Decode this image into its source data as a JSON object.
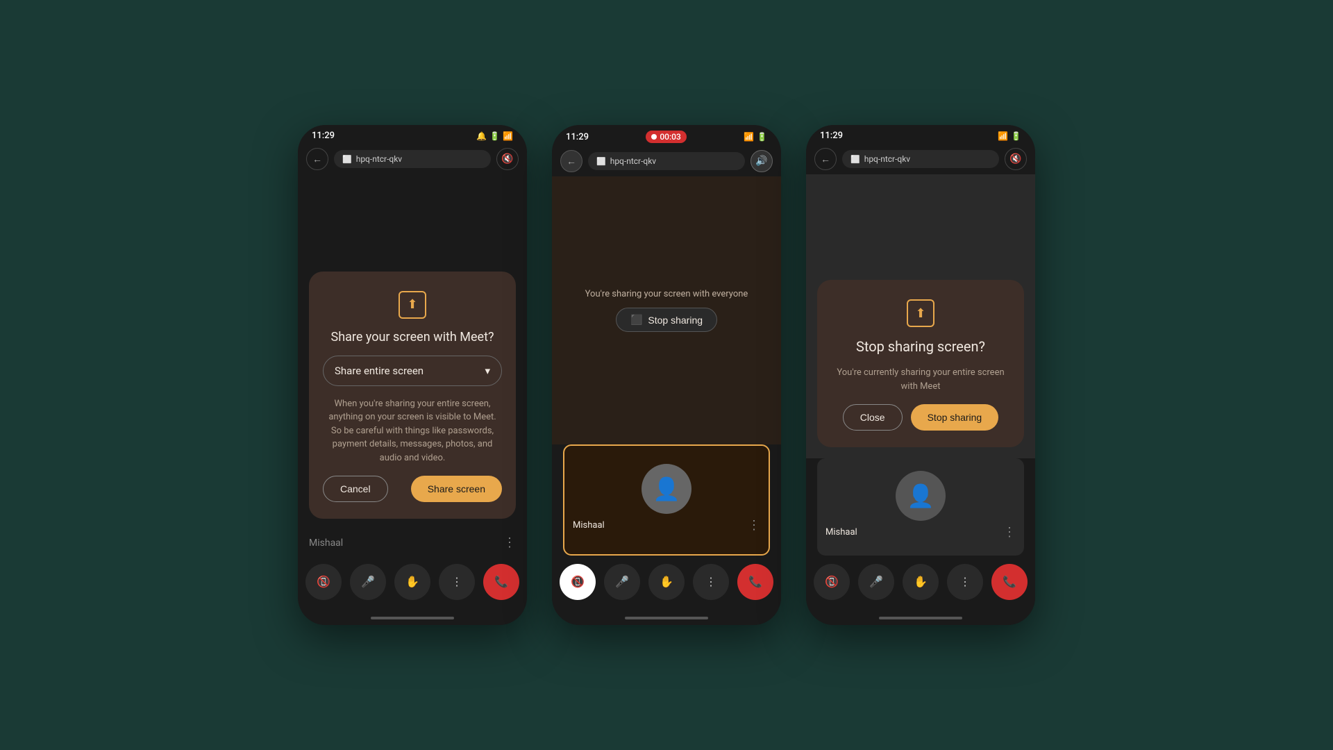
{
  "background": "#1a3a35",
  "phones": [
    {
      "id": "phone1",
      "status_bar": {
        "time": "11:29",
        "icons": [
          "notification",
          "battery",
          "wifi"
        ],
        "recording": null
      },
      "nav": {
        "back_label": "←",
        "url": "hpq-ntcr-qkv",
        "sound_icon": "🔇"
      },
      "modal": {
        "icon": "⬆",
        "title": "Share your screen with Meet?",
        "dropdown_label": "Share entire screen",
        "dropdown_icon": "▾",
        "description": "When you're sharing your entire screen, anything on your screen is visible to Meet. So be careful with things like passwords, payment details, messages, photos, and audio and video.",
        "cancel_label": "Cancel",
        "share_label": "Share screen"
      },
      "user_bar": {
        "name": "Mishaal",
        "dots": "⋮"
      },
      "controls": [
        "📵",
        "🎤",
        "✋",
        "⋮",
        "📞"
      ]
    },
    {
      "id": "phone2",
      "status_bar": {
        "time": "11:29",
        "recording_label": "00:03"
      },
      "nav": {
        "back_label": "←",
        "url": "hpq-ntcr-qkv",
        "sound_icon": "🔊"
      },
      "share_area": {
        "message": "You're sharing your screen with everyone",
        "stop_sharing_label": "Stop sharing",
        "stop_icon": "⬛"
      },
      "participant": {
        "name": "Mishaal",
        "dots": "⋮"
      },
      "controls": [
        "📵",
        "🎤",
        "✋",
        "⋮",
        "📞"
      ]
    },
    {
      "id": "phone3",
      "status_bar": {
        "time": "11:29"
      },
      "nav": {
        "back_label": "←",
        "url": "hpq-ntcr-qkv",
        "sound_icon": "🔇"
      },
      "modal": {
        "icon": "⬆",
        "title": "Stop sharing screen?",
        "description": "You're currently sharing your entire screen with Meet",
        "close_label": "Close",
        "stop_label": "Stop sharing"
      },
      "participant": {
        "name": "Mishaal",
        "dots": "⋮"
      },
      "controls": [
        "📵",
        "🎤",
        "✋",
        "⋮",
        "📞"
      ]
    }
  ]
}
